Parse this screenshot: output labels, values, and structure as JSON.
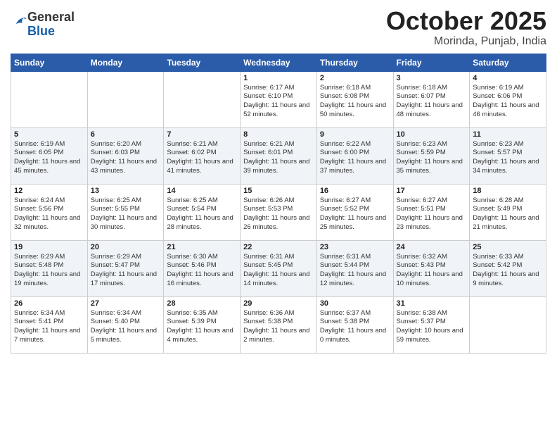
{
  "header": {
    "logo_general": "General",
    "logo_blue": "Blue",
    "month": "October 2025",
    "location": "Morinda, Punjab, India"
  },
  "days_of_week": [
    "Sunday",
    "Monday",
    "Tuesday",
    "Wednesday",
    "Thursday",
    "Friday",
    "Saturday"
  ],
  "weeks": [
    [
      {
        "day": "",
        "info": ""
      },
      {
        "day": "",
        "info": ""
      },
      {
        "day": "",
        "info": ""
      },
      {
        "day": "1",
        "info": "Sunrise: 6:17 AM\nSunset: 6:10 PM\nDaylight: 11 hours\nand 52 minutes."
      },
      {
        "day": "2",
        "info": "Sunrise: 6:18 AM\nSunset: 6:08 PM\nDaylight: 11 hours\nand 50 minutes."
      },
      {
        "day": "3",
        "info": "Sunrise: 6:18 AM\nSunset: 6:07 PM\nDaylight: 11 hours\nand 48 minutes."
      },
      {
        "day": "4",
        "info": "Sunrise: 6:19 AM\nSunset: 6:06 PM\nDaylight: 11 hours\nand 46 minutes."
      }
    ],
    [
      {
        "day": "5",
        "info": "Sunrise: 6:19 AM\nSunset: 6:05 PM\nDaylight: 11 hours\nand 45 minutes."
      },
      {
        "day": "6",
        "info": "Sunrise: 6:20 AM\nSunset: 6:03 PM\nDaylight: 11 hours\nand 43 minutes."
      },
      {
        "day": "7",
        "info": "Sunrise: 6:21 AM\nSunset: 6:02 PM\nDaylight: 11 hours\nand 41 minutes."
      },
      {
        "day": "8",
        "info": "Sunrise: 6:21 AM\nSunset: 6:01 PM\nDaylight: 11 hours\nand 39 minutes."
      },
      {
        "day": "9",
        "info": "Sunrise: 6:22 AM\nSunset: 6:00 PM\nDaylight: 11 hours\nand 37 minutes."
      },
      {
        "day": "10",
        "info": "Sunrise: 6:23 AM\nSunset: 5:59 PM\nDaylight: 11 hours\nand 35 minutes."
      },
      {
        "day": "11",
        "info": "Sunrise: 6:23 AM\nSunset: 5:57 PM\nDaylight: 11 hours\nand 34 minutes."
      }
    ],
    [
      {
        "day": "12",
        "info": "Sunrise: 6:24 AM\nSunset: 5:56 PM\nDaylight: 11 hours\nand 32 minutes."
      },
      {
        "day": "13",
        "info": "Sunrise: 6:25 AM\nSunset: 5:55 PM\nDaylight: 11 hours\nand 30 minutes."
      },
      {
        "day": "14",
        "info": "Sunrise: 6:25 AM\nSunset: 5:54 PM\nDaylight: 11 hours\nand 28 minutes."
      },
      {
        "day": "15",
        "info": "Sunrise: 6:26 AM\nSunset: 5:53 PM\nDaylight: 11 hours\nand 26 minutes."
      },
      {
        "day": "16",
        "info": "Sunrise: 6:27 AM\nSunset: 5:52 PM\nDaylight: 11 hours\nand 25 minutes."
      },
      {
        "day": "17",
        "info": "Sunrise: 6:27 AM\nSunset: 5:51 PM\nDaylight: 11 hours\nand 23 minutes."
      },
      {
        "day": "18",
        "info": "Sunrise: 6:28 AM\nSunset: 5:49 PM\nDaylight: 11 hours\nand 21 minutes."
      }
    ],
    [
      {
        "day": "19",
        "info": "Sunrise: 6:29 AM\nSunset: 5:48 PM\nDaylight: 11 hours\nand 19 minutes."
      },
      {
        "day": "20",
        "info": "Sunrise: 6:29 AM\nSunset: 5:47 PM\nDaylight: 11 hours\nand 17 minutes."
      },
      {
        "day": "21",
        "info": "Sunrise: 6:30 AM\nSunset: 5:46 PM\nDaylight: 11 hours\nand 16 minutes."
      },
      {
        "day": "22",
        "info": "Sunrise: 6:31 AM\nSunset: 5:45 PM\nDaylight: 11 hours\nand 14 minutes."
      },
      {
        "day": "23",
        "info": "Sunrise: 6:31 AM\nSunset: 5:44 PM\nDaylight: 11 hours\nand 12 minutes."
      },
      {
        "day": "24",
        "info": "Sunrise: 6:32 AM\nSunset: 5:43 PM\nDaylight: 11 hours\nand 10 minutes."
      },
      {
        "day": "25",
        "info": "Sunrise: 6:33 AM\nSunset: 5:42 PM\nDaylight: 11 hours\nand 9 minutes."
      }
    ],
    [
      {
        "day": "26",
        "info": "Sunrise: 6:34 AM\nSunset: 5:41 PM\nDaylight: 11 hours\nand 7 minutes."
      },
      {
        "day": "27",
        "info": "Sunrise: 6:34 AM\nSunset: 5:40 PM\nDaylight: 11 hours\nand 5 minutes."
      },
      {
        "day": "28",
        "info": "Sunrise: 6:35 AM\nSunset: 5:39 PM\nDaylight: 11 hours\nand 4 minutes."
      },
      {
        "day": "29",
        "info": "Sunrise: 6:36 AM\nSunset: 5:38 PM\nDaylight: 11 hours\nand 2 minutes."
      },
      {
        "day": "30",
        "info": "Sunrise: 6:37 AM\nSunset: 5:38 PM\nDaylight: 11 hours\nand 0 minutes."
      },
      {
        "day": "31",
        "info": "Sunrise: 6:38 AM\nSunset: 5:37 PM\nDaylight: 10 hours\nand 59 minutes."
      },
      {
        "day": "",
        "info": ""
      }
    ]
  ]
}
